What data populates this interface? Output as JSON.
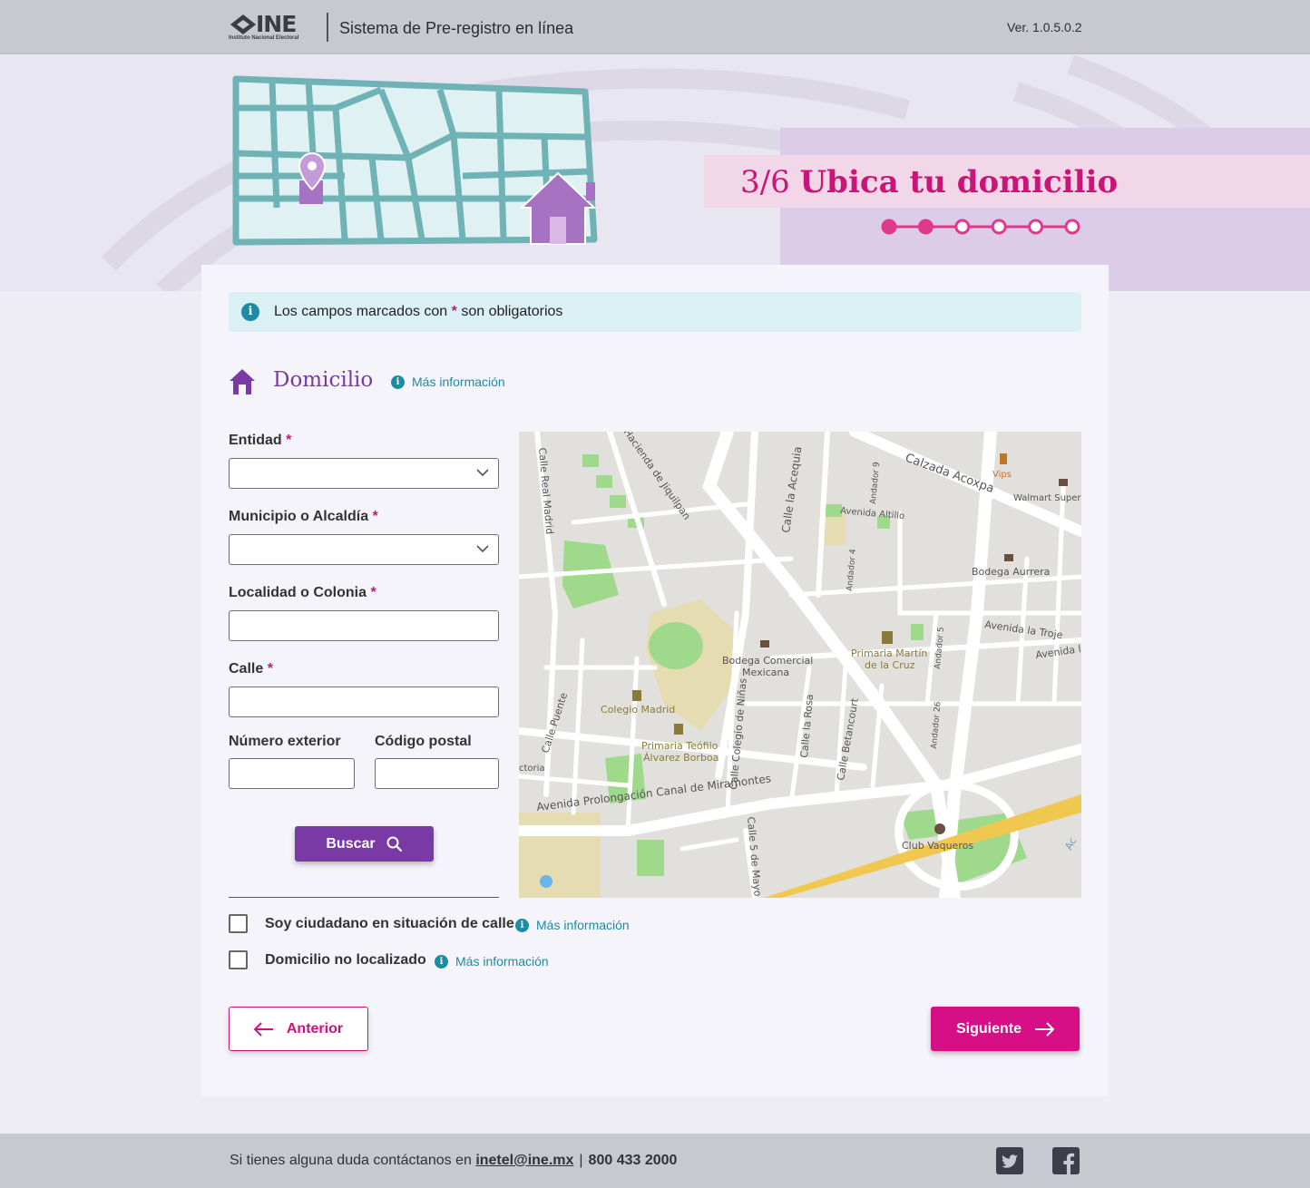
{
  "header": {
    "logo_text": "INE",
    "logo_sub": "Instituto Nacional Electoral",
    "app_title": "Sistema de Pre-registro en línea",
    "version": "Ver. 1.0.5.0.2"
  },
  "hero": {
    "step_number": "3/6",
    "step_title": "Ubica tu domicilio",
    "progress_total": 6,
    "progress_completed": 2,
    "progress_color": "#e0388e"
  },
  "notice": {
    "text_before": "Los campos marcados con ",
    "asterisk": "*",
    "text_after": " son obligatorios"
  },
  "section": {
    "title": "Domicilio",
    "more_info": "Más información",
    "icon": "home-icon"
  },
  "form": {
    "entidad_label": "Entidad",
    "entidad_value": "",
    "municipio_label": "Municipio o Alcaldía",
    "municipio_value": "",
    "localidad_label": "Localidad o Colonia",
    "localidad_value": "",
    "calle_label": "Calle",
    "calle_value": "",
    "numero_label": "Número exterior",
    "numero_value": "",
    "cp_label": "Código postal",
    "cp_value": "",
    "required_mark": "*",
    "search_button": "Buscar"
  },
  "map": {
    "labels": {
      "calzada_acoxpa": "Calzada Acoxpa",
      "vips": "Vips",
      "walmart": "Walmart Super",
      "bodega_aurrera": "Bodega Aurrera",
      "avenida_altillo": "Avenida Altillo",
      "andador_9": "Andador 9",
      "andador_4": "Andador 4",
      "andador_5": "Andador 5",
      "andador_26": "Andador 26",
      "avenida_troje": "Avenida la Troje",
      "avenida_la": "Avenida la",
      "calle_acequia": "Calle la Acequia",
      "hacienda_jiquilpan": "Hacienda de Jiquilpan",
      "calle_real_madrid": "Calle Real Madrid",
      "bodega_comercial": "Bodega Comercial",
      "mexicana": "Mexicana",
      "primaria_martin": "Primaria Martín",
      "de_la_cruz": "de la Cruz",
      "colegio_madrid": "Colegio Madrid",
      "primaria_teofilo": "Primaria Teófilo",
      "alvarez_borboa": "Álvarez Borboa",
      "calle_puente": "Calle Puente",
      "ctoria": "ctoria",
      "calle_colegio_ninas": "Calle Colegio de Niñas",
      "calle_la_rosa": "Calle la Rosa",
      "calle_betancourt": "Calle Betancourt",
      "avenida_prolongacion": "Avenida Prolongación Canal de Miramontes",
      "calle_5_mayo": "Calle 5 de Mayo",
      "club_vaqueros": "Club Vaqueros",
      "ac": "Ac"
    },
    "colors": {
      "land": "#e2e0dc",
      "road": "#ffffff",
      "park": "#9fd98c",
      "campus": "#e6dcb2",
      "highway": "#f0c850",
      "label": "#555555"
    }
  },
  "options": {
    "situacion_calle_label": "Soy ciudadano en situación de calle",
    "situacion_calle_checked": false,
    "no_localizado_label": "Domicilio no localizado",
    "no_localizado_checked": false,
    "more_info": "Más información"
  },
  "nav": {
    "prev_label": "Anterior",
    "next_label": "Siguiente"
  },
  "footer": {
    "text": "Si tienes alguna duda contáctanos en ",
    "email": "inetel@ine.mx",
    "separator": "|",
    "phone": "800 433 2000",
    "social": [
      "twitter-icon",
      "facebook-icon"
    ]
  },
  "colors": {
    "brand_purple": "#7a3aa6",
    "brand_pink": "#cc1478",
    "info_teal": "#1c8ba4",
    "header_gray": "#c7c8d0"
  }
}
